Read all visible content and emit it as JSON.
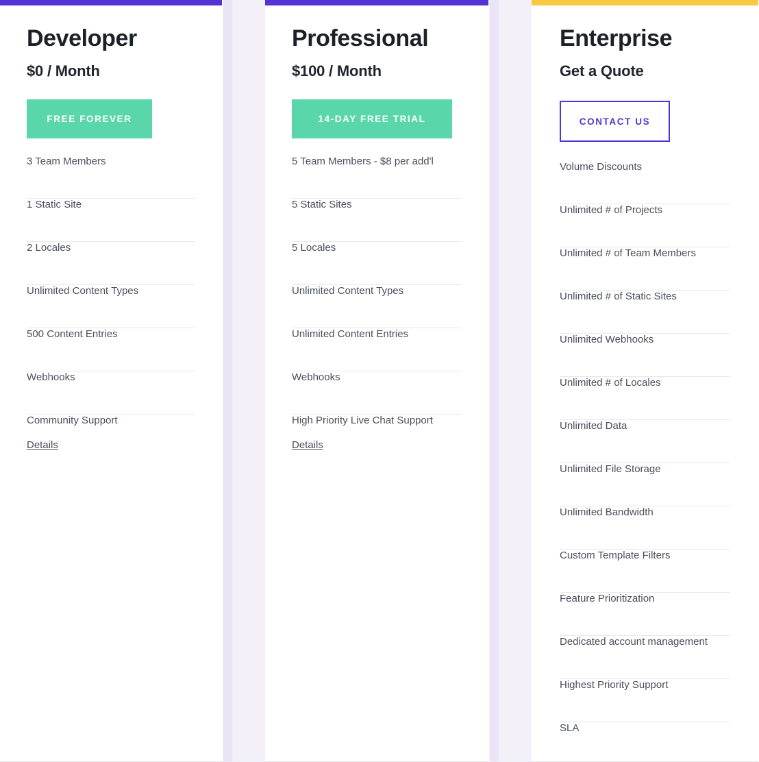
{
  "accent_colors": {
    "purple": "#5433d6",
    "yellow": "#f9c941",
    "green": "#59d7ab",
    "text_dark": "#1d2029",
    "text_body": "#4a4f5c",
    "divider": "#e9e9ec",
    "gutter": "#f3f0f9"
  },
  "plans": [
    {
      "id": "developer",
      "name": "Developer",
      "price": "$0 / Month",
      "accent": "#5433d6",
      "cta_label": "FREE FOREVER",
      "cta_style": "solid",
      "features": [
        "3 Team Members",
        "1 Static Site",
        "2 Locales",
        "Unlimited Content Types",
        "500 Content Entries",
        "Webhooks",
        "Community Support"
      ],
      "details_label": "Details"
    },
    {
      "id": "professional",
      "name": "Professional",
      "price": "$100 / Month",
      "accent": "#5433d6",
      "cta_label": "14-DAY FREE TRIAL",
      "cta_style": "solid",
      "features": [
        "5 Team Members - $8 per add'l",
        "5 Static Sites",
        "5 Locales",
        "Unlimited Content Types",
        "Unlimited Content Entries",
        "Webhooks",
        "High Priority Live Chat Support"
      ],
      "details_label": "Details"
    },
    {
      "id": "enterprise",
      "name": "Enterprise",
      "price": "Get a Quote",
      "accent": "#f9c941",
      "cta_label": "CONTACT US",
      "cta_style": "outline",
      "features": [
        "Volume Discounts",
        "Unlimited # of Projects",
        "Unlimited # of Team Members",
        "Unlimited # of Static Sites",
        "Unlimited Webhooks",
        "Unlimited # of Locales",
        "Unlimited Data",
        "Unlimited File Storage",
        "Unlimited Bandwidth",
        "Custom Template Filters",
        "Feature Prioritization",
        "Dedicated account management",
        "Highest Priority Support",
        "SLA"
      ],
      "details_label": ""
    }
  ]
}
